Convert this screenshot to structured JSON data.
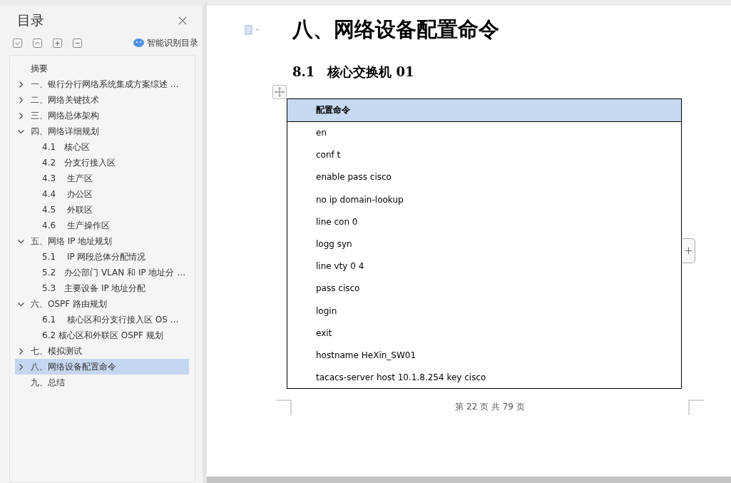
{
  "sidebar": {
    "title": "目录",
    "smart_toc_label": "智能识别目录",
    "items": [
      {
        "label": "摘要",
        "selected": false
      },
      {
        "label": "一、银行分行网络系统集成方案综述 …",
        "selected": false,
        "expanded": false
      },
      {
        "label": "二、网络关键技术",
        "selected": false,
        "expanded": false
      },
      {
        "label": "三、网络总体架构",
        "selected": false,
        "expanded": false
      },
      {
        "label": "四、网络详细规划",
        "selected": false,
        "expanded": true,
        "children": [
          {
            "label": "4.1　核心区",
            "selected": false
          },
          {
            "label": "4.2　分支行接入区",
            "selected": false
          },
          {
            "label": "4.3　 生产区",
            "selected": false
          },
          {
            "label": "4.4　 办公区",
            "selected": false
          },
          {
            "label": "4.5　 外联区",
            "selected": false
          },
          {
            "label": "4.6　 生产操作区",
            "selected": false
          }
        ]
      },
      {
        "label": "五、网络 IP 地址规划",
        "selected": false,
        "expanded": true,
        "children": [
          {
            "label": "5.1　 IP 网段总体分配情况",
            "selected": false
          },
          {
            "label": "5.2　办公部门 VLAN 和 IP 地址分 …",
            "selected": false
          },
          {
            "label": "5.3　主要设备 IP 地址分配",
            "selected": false
          }
        ]
      },
      {
        "label": "六、OSPF 路由规划",
        "selected": false,
        "expanded": true,
        "children": [
          {
            "label": "6.1　 核心区和分支行接入区 OS …",
            "selected": false
          },
          {
            "label": "6.2 核心区和外联区 OSPF 规划",
            "selected": false
          }
        ]
      },
      {
        "label": "七、模拟测试",
        "selected": false,
        "expanded": false
      },
      {
        "label": "八、网络设备配置命令",
        "selected": true,
        "expanded": false
      },
      {
        "label": "九、总结",
        "selected": false
      }
    ]
  },
  "document": {
    "heading": "八、网络设备配置命令",
    "subheading": "8.1　核心交换机 01",
    "table": {
      "columns": [
        "配置命令"
      ],
      "rows": [
        "en",
        "conf t",
        "enable pass cisco",
        "no ip domain-lookup",
        "line con 0",
        "logg syn",
        "line vty 0 4",
        "pass cisco",
        "login",
        "exit",
        "hostname HeXin_SW01",
        "tacacs-server host 10.1.8.254 key cisco"
      ]
    },
    "footer": "第 22 页 共 79 页"
  }
}
